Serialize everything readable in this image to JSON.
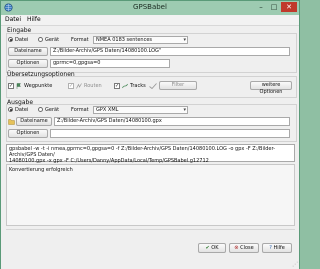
{
  "window": {
    "title": "GPSBabel",
    "minimize": "–",
    "maximize": "□",
    "close": "✕"
  },
  "menu": [
    "Datei",
    "Hilfe"
  ],
  "input": {
    "group_label": "Eingabe",
    "radio_file": "Datei",
    "radio_device": "Gerät",
    "format_label": "Format",
    "format_value": "NMEA 0183 sentences",
    "filename_button": "Dateiname",
    "filename_value": "Z:/Bilder-Archiv/GPS Daten/14080100.LOG\"",
    "options_button": "Optionen",
    "options_value": "gprmc=0,gpgsa=0"
  },
  "translation": {
    "group_label": "Übersetzungsoptionen",
    "waypoints": "Wegpunkte",
    "routes": "Routen",
    "tracks": "Tracks",
    "filter_button": "Filter",
    "more_options_button": "weitere Optionen"
  },
  "output": {
    "group_label": "Ausgabe",
    "radio_file": "Datei",
    "radio_device": "Gerät",
    "format_label": "Format",
    "format_value": "GPX XML",
    "filename_button": "Dateiname",
    "filename_value": "Z:/Bilder-Archiv/GPS Daten/14080100.gpx",
    "options_button": "Optionen",
    "options_value": ""
  },
  "command": {
    "line1": "gpsbabel -w -t -i nmea,gprmc=0,gpgsa=0 -f Z:/Bilder-Archiv/GPS Daten/14080100.LOG -o gpx -F Z:/Bilder-Archiv/GPS Daten/",
    "line2": "14080100.gpx -x gpx -F C:/Users/Danny/AppData/Local/Temp/GPSBabel.g12712"
  },
  "log": {
    "message": "Konvertierung erfolgreich"
  },
  "buttons": {
    "ok": "OK",
    "close": "Close",
    "help": "Hilfe"
  },
  "colors": {
    "titlebar": "#9dcbb1",
    "accent_green": "#4a8a5a",
    "close": "#c0392b"
  },
  "icons": {
    "app": "gpsbabel-globe-icon",
    "file": "folder-icon",
    "ok": "checkmark-icon",
    "close": "cancel-icon",
    "help": "question-icon"
  }
}
